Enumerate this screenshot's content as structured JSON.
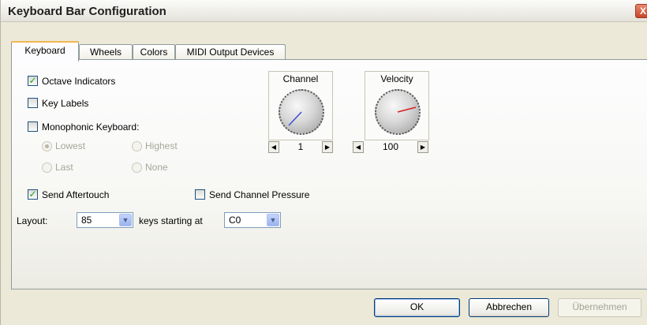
{
  "window": {
    "title": "Keyboard Bar Configuration",
    "close_label": "X"
  },
  "tabs": [
    {
      "label": "Keyboard",
      "active": true
    },
    {
      "label": "Wheels",
      "active": false
    },
    {
      "label": "Colors",
      "active": false
    },
    {
      "label": "MIDI Output Devices",
      "active": false
    }
  ],
  "options": {
    "octave_indicators": {
      "label": "Octave Indicators",
      "checked": true
    },
    "key_labels": {
      "label": "Key Labels",
      "checked": false
    },
    "monophonic": {
      "label": "Monophonic Keyboard:",
      "checked": false
    },
    "radios": {
      "lowest": "Lowest",
      "highest": "Highest",
      "last": "Last",
      "none": "None",
      "selected": "Lowest"
    },
    "send_aftertouch": {
      "label": "Send Aftertouch",
      "checked": true
    },
    "send_channel_pressure": {
      "label": "Send Channel Pressure",
      "checked": false
    }
  },
  "knobs": {
    "channel": {
      "label": "Channel",
      "value": "1"
    },
    "velocity": {
      "label": "Velocity",
      "value": "100"
    }
  },
  "layout": {
    "label": "Layout:",
    "keys_value": "85",
    "keys_starting_label": "keys starting at",
    "start_value": "C0"
  },
  "buttons": {
    "ok": "OK",
    "cancel": "Abbrechen",
    "apply": "Übernehmen"
  },
  "colors": {
    "tab_highlight": "#f3b54f",
    "check_green": "#21a121",
    "channel_needle": "#3b4fd6",
    "velocity_needle": "#d62020"
  }
}
